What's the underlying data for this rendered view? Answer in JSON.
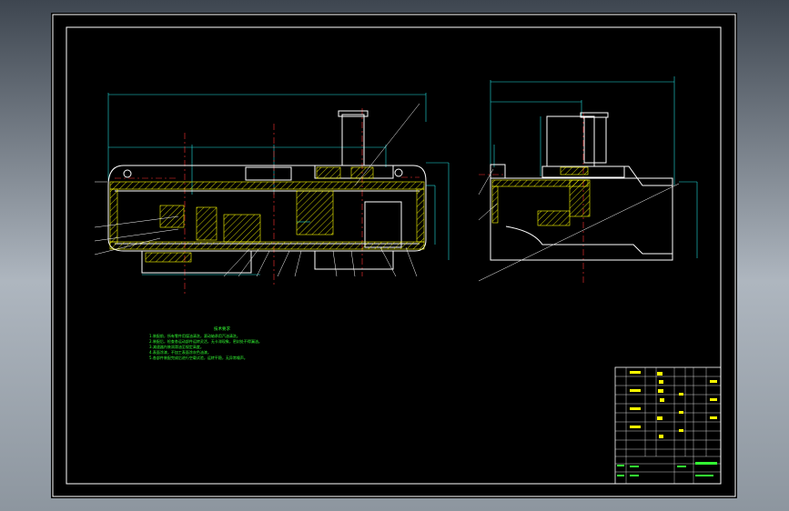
{
  "notes": {
    "title": "技术要求",
    "lines": [
      "1.装配前，所有零件用煤油清洗，滚动轴承用汽油清洗。",
      "2.装配后，检查各运动部件运转灵活，无卡滞现象，密封处不得漏油。",
      "3.减速器内装润滑油至规定高度。",
      "4.表面涂漆，不加工表面涂灰色油漆。",
      "5.各部件装配完成后进行空载试验，运转平稳，无异常噪声。"
    ]
  },
  "colors": {
    "background": "#000000",
    "outline": "#ffffff",
    "dimension": "#22dddd",
    "centerline": "#ff3333",
    "hatch": "#ffff00",
    "text": "#33ff33"
  }
}
